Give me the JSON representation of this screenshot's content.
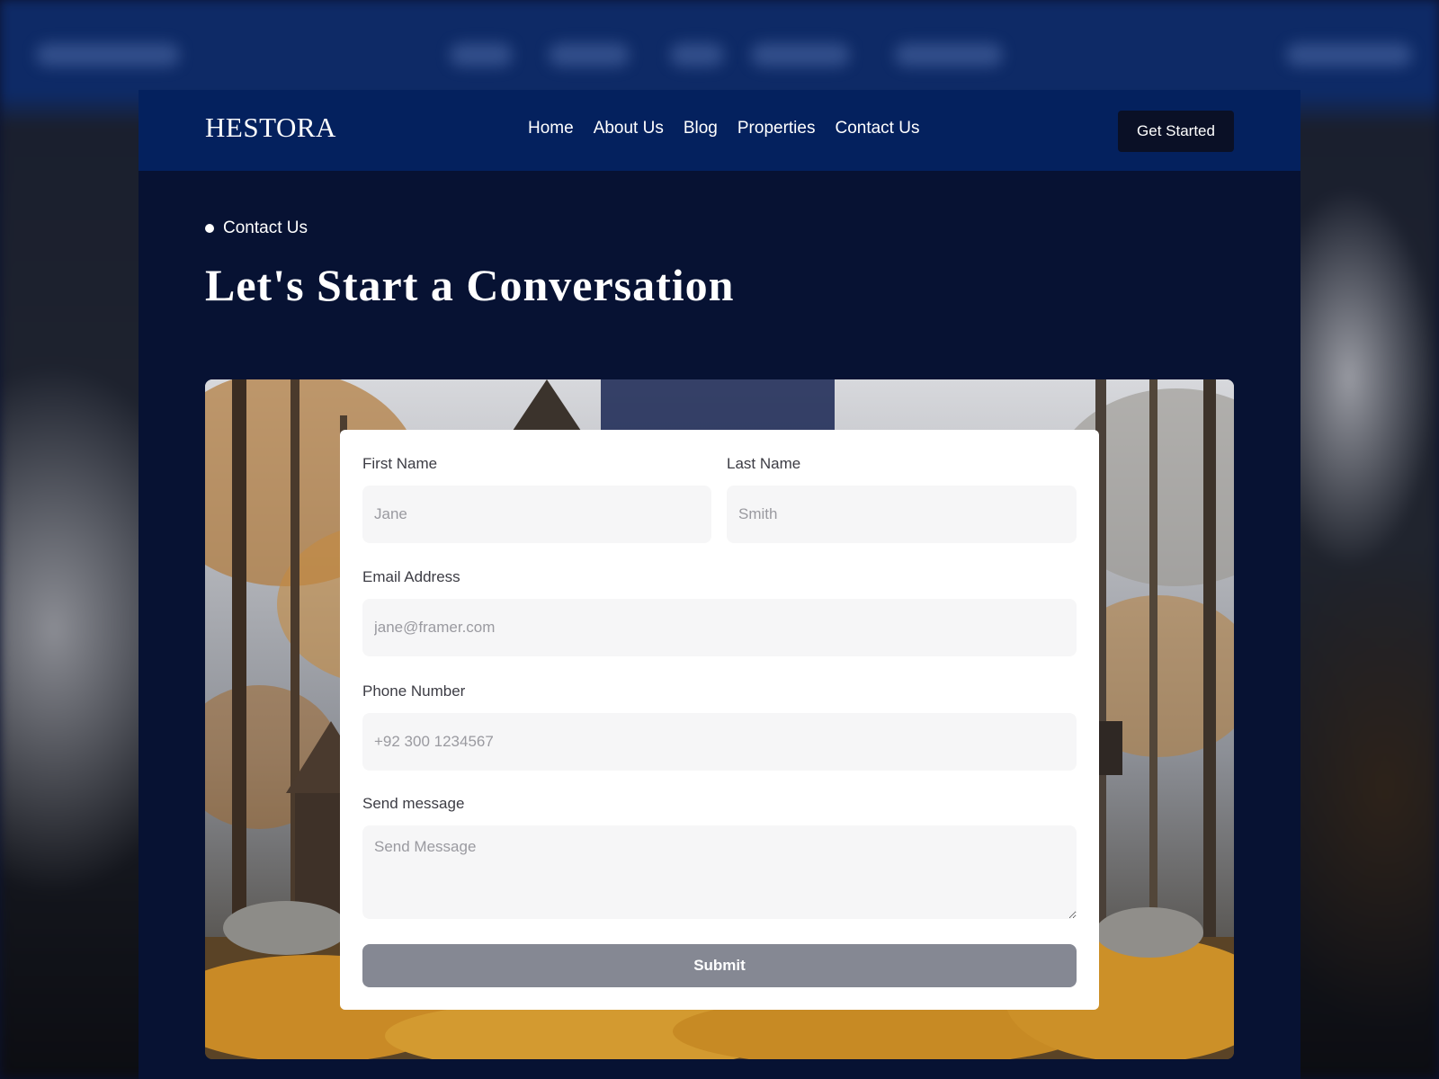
{
  "navbar": {
    "logo": "HESTORA",
    "links": [
      {
        "label": "Home"
      },
      {
        "label": "About Us"
      },
      {
        "label": "Blog"
      },
      {
        "label": "Properties"
      },
      {
        "label": "Contact Us"
      }
    ],
    "cta_label": "Get Started"
  },
  "hero": {
    "breadcrumb": "Contact Us",
    "title": "Let's Start a Conversation"
  },
  "form": {
    "first_name": {
      "label": "First Name",
      "placeholder": "Jane"
    },
    "last_name": {
      "label": "Last Name",
      "placeholder": "Smith"
    },
    "email": {
      "label": "Email Address",
      "placeholder": "jane@framer.com"
    },
    "phone": {
      "label": "Phone Number",
      "placeholder": "+92 300 1234567"
    },
    "message": {
      "label": "Send message",
      "placeholder": "Send Message"
    },
    "submit_label": "Submit"
  },
  "colors": {
    "navbar_bg": "#04215e",
    "page_bg": "#071233",
    "cta_bg": "#0a1026",
    "submit_bg": "#858893",
    "input_bg": "#f6f6f7"
  },
  "icons": {
    "breadcrumb": "dot-icon",
    "textarea": "resize-handle-icon"
  }
}
